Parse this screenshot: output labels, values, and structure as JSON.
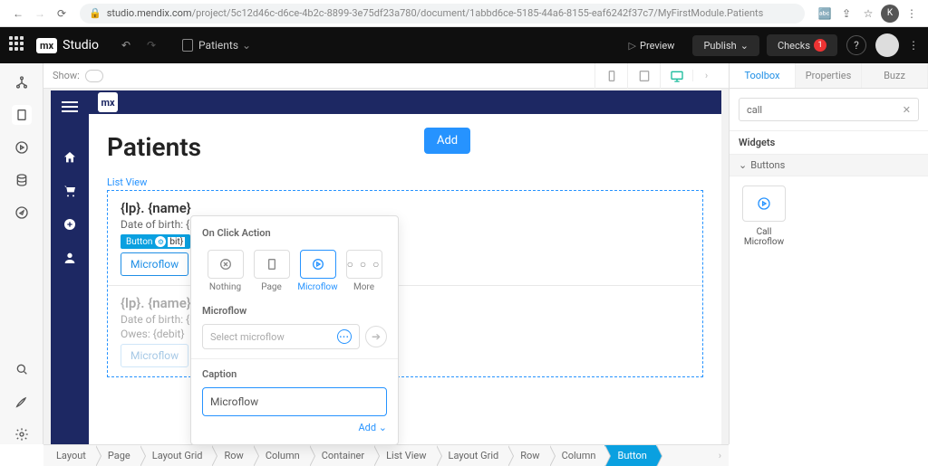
{
  "browser": {
    "url_host": "studio.mendix.com",
    "url_path": "/project/5c12d46c-d6ce-4b2c-8899-3e75df23a780/document/1abbd6ce-5185-44a6-8155-eaf6242f37c7/MyFirstModule.Patients",
    "avatar_letter": "K"
  },
  "studio": {
    "logo": "mx",
    "name": "Studio",
    "doc_name": "Patients",
    "preview": "Preview",
    "publish": "Publish",
    "checks": "Checks",
    "checks_count": "1"
  },
  "show_bar": {
    "label": "Show:"
  },
  "page": {
    "title": "Patients",
    "add_btn": "Add",
    "listview_label": "List View",
    "row1_name": "{lp}. {name}",
    "row1_dob": "Date of birth: {b",
    "row1_btn_tag": "Button",
    "row1_btn_tag2": "bit}",
    "row1_mf": "Microflow",
    "row2_name": "{lp}. {name}",
    "row2_dob": "Date of birth: {b",
    "row2_owes": "Owes: {debit}",
    "row2_mf": "Microflow"
  },
  "popover": {
    "section_onclick": "On Click Action",
    "opt_nothing": "Nothing",
    "opt_page": "Page",
    "opt_microflow": "Microflow",
    "opt_more": "More",
    "section_mf": "Microflow",
    "mf_placeholder": "Select microflow",
    "section_caption": "Caption",
    "caption_value": "Microflow",
    "add_link": "Add"
  },
  "right": {
    "tab_toolbox": "Toolbox",
    "tab_properties": "Properties",
    "tab_buzz": "Buzz",
    "search_value": "call",
    "widgets_title": "Widgets",
    "buttons_group": "Buttons",
    "widget_call_mf": "Call Microflow"
  },
  "breadcrumb": [
    "Layout",
    "Page",
    "Layout Grid",
    "Row",
    "Column",
    "Container",
    "List View",
    "Layout Grid",
    "Row",
    "Column",
    "Button"
  ]
}
